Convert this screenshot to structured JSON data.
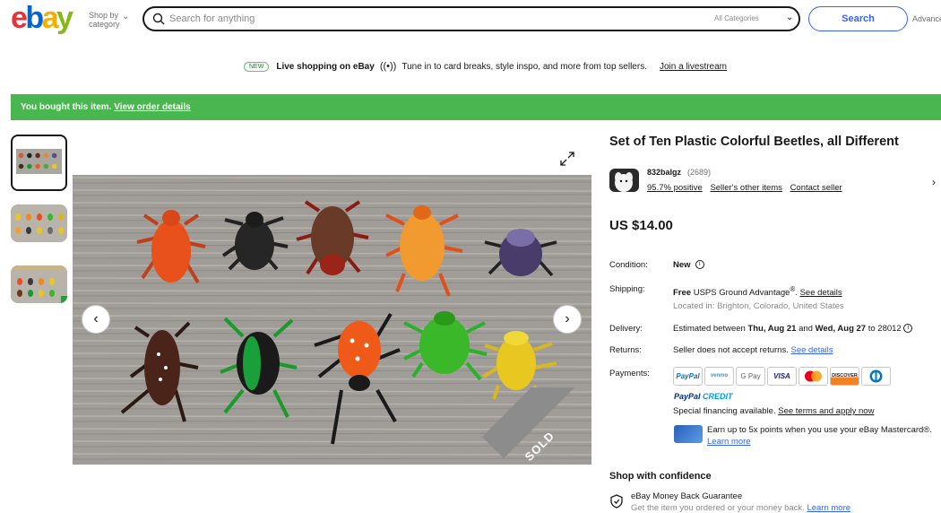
{
  "header": {
    "logo": {
      "e": "e",
      "b": "b",
      "a": "a",
      "y": "y"
    },
    "shop_by": "Shop by",
    "category": "category",
    "search_placeholder": "Search for anything",
    "all_categories": "All Categories",
    "search_button": "Search",
    "advanced": "Advance"
  },
  "promo": {
    "badge": "NEW",
    "title": "Live shopping on eBay",
    "text": "Tune in to card breaks, style inspo, and more from top sellers.",
    "link": "Join a livestream"
  },
  "banner": {
    "text": "You bought this item.",
    "link": "View order details",
    "color": "#4ab64f"
  },
  "image": {
    "sold_label": "SOLD"
  },
  "listing": {
    "title": "Set of Ten Plastic Colorful Beetles, all Different",
    "seller": {
      "name": "832balgz",
      "feedback_count": "(2689)",
      "positive": "95.7% positive",
      "other_items": "Seller's other items",
      "contact": "Contact seller"
    },
    "price": "US $14.00",
    "condition": {
      "label": "Condition:",
      "value": "New"
    },
    "shipping": {
      "label": "Shipping:",
      "free": "Free",
      "service": "USPS Ground Advantage",
      "sup": "®",
      "see_details": "See details",
      "location": "Located in: Brighton, Colorado, United States"
    },
    "delivery": {
      "label": "Delivery:",
      "prefix": "Estimated between",
      "start": "Thu, Aug 21",
      "and": "and",
      "end": "Wed, Aug 27",
      "to": "to 28012"
    },
    "returns": {
      "label": "Returns:",
      "value": "Seller does not accept returns.",
      "link": "See details"
    },
    "payments": {
      "label": "Payments:",
      "methods": [
        "PayPal",
        "venmo",
        "G Pay",
        "VISA",
        "MC",
        "DISCOVER",
        "Diners"
      ],
      "pp_credit_a": "PayPal",
      "pp_credit_b": "CREDIT",
      "financing": "Special financing available.",
      "financing_link": "See terms and apply now",
      "mastercard_text": "Earn up to 5x points when you use your eBay Mastercard®.",
      "learn_more": "Learn more"
    },
    "confidence": {
      "title": "Shop with confidence",
      "mbg_title": "eBay Money Back Guarantee",
      "mbg_sub": "Get the item you ordered or your money back.",
      "mbg_link": "Learn more"
    }
  }
}
